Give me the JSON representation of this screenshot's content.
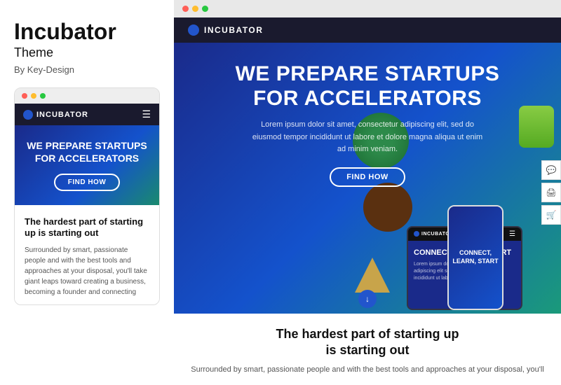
{
  "left": {
    "title": "Incubator",
    "subtitle": "Theme",
    "author": "By Key-Design",
    "mobile_preview": {
      "nav": {
        "logo": "INCUBATOR"
      },
      "hero": {
        "title": "WE PREPARE STARTUPS FOR ACCELERATORS",
        "button": "FIND HOW"
      },
      "content": {
        "title": "The hardest part of starting up is starting out",
        "text": "Surrounded by smart, passionate people and with the best tools and approaches at your disposal, you'll take giant leaps toward creating a business, becoming a founder and connecting"
      }
    }
  },
  "right": {
    "site": {
      "nav": {
        "logo": "INCUBATOR"
      },
      "hero": {
        "title_line1": "WE PREPARE STARTUPS",
        "title_line2": "FOR ACCELERATORS",
        "description": "Lorem ipsum dolor sit amet, consectetur adipiscing elit, sed do eiusmod tempor incididunt ut labore et dolore magna aliqua ut enim ad minim veniam.",
        "button": "FIND HOW"
      },
      "phone": {
        "text": "CONNECT, LEARN, START"
      },
      "tablet": {
        "logo": "INCUBATOR",
        "title": "CONNECT, LEARN, START",
        "text": "Lorem ipsum dolor sit amet consectetur adipiscing elit sed do eiusmod tempor incididunt ut labore"
      },
      "bottom": {
        "title_line1": "The hardest part of starting up",
        "title_line2": "is starting out",
        "text": "Surrounded by smart, passionate people and with the best tools and approaches at your disposal, you'll"
      }
    },
    "toolbar": {
      "icons": [
        "💬",
        "🖨",
        "🛒"
      ]
    }
  }
}
